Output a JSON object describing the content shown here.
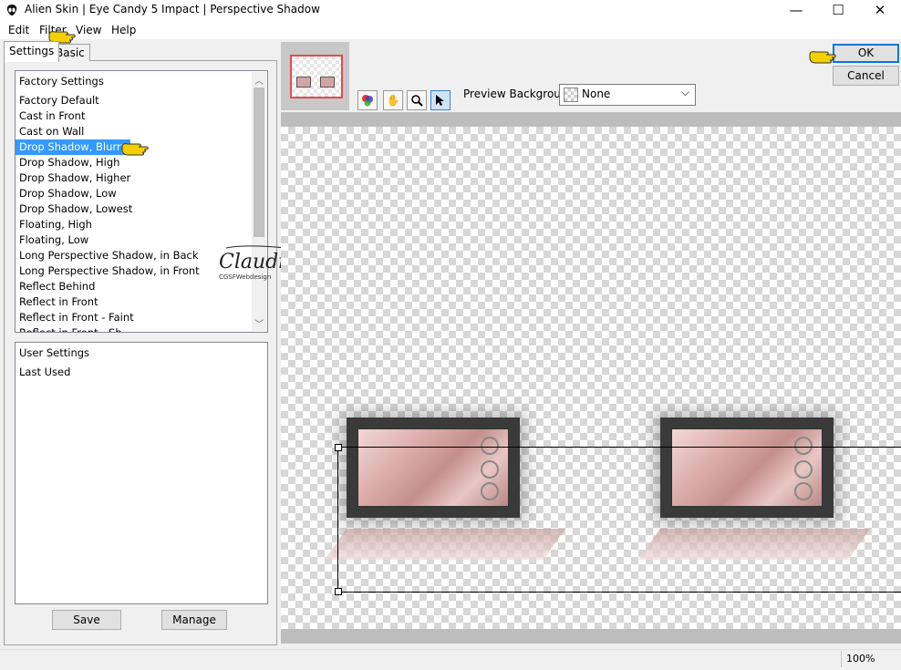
{
  "window": {
    "title": "Alien Skin | Eye Candy 5 Impact | Perspective Shadow",
    "controls": [
      "—",
      "☐",
      "✕"
    ]
  },
  "menu": [
    "Edit",
    "Filter",
    "View",
    "Help"
  ],
  "tabs": {
    "settings": "Settings",
    "basic": "Basic"
  },
  "factory_settings": {
    "header": "Factory Settings",
    "items": [
      "Factory Default",
      "Cast in Front",
      "Cast on Wall",
      "Drop Shadow, Blurry",
      "Drop Shadow, High",
      "Drop Shadow, Higher",
      "Drop Shadow, Low",
      "Drop Shadow, Lowest",
      "Floating, High",
      "Floating, Low",
      "Long Perspective Shadow, in Back",
      "Long Perspective Shadow, in Front",
      "Reflect Behind",
      "Reflect in Front",
      "Reflect in Front - Faint",
      "Reflect in Front - Sh..."
    ],
    "selected": "Drop Shadow, Blurry"
  },
  "user_settings": {
    "header": "User Settings",
    "items": [
      "Last Used"
    ]
  },
  "buttons": {
    "save": "Save",
    "manage": "Manage",
    "ok": "OK",
    "cancel": "Cancel"
  },
  "preview": {
    "background_label": "Preview Background:",
    "background_value": "None",
    "tools": [
      "swatch-tool-icon",
      "hand-tool-icon",
      "zoom-tool-icon",
      "select-tool-icon"
    ]
  },
  "status": {
    "zoom": "100%"
  },
  "watermark": {
    "name": "Claudia",
    "sub": "CGSFWebdesign"
  },
  "colors": {
    "selection": "#3399ff",
    "accent_border": "#0078d7",
    "thumb_border": "#e34a4a"
  }
}
